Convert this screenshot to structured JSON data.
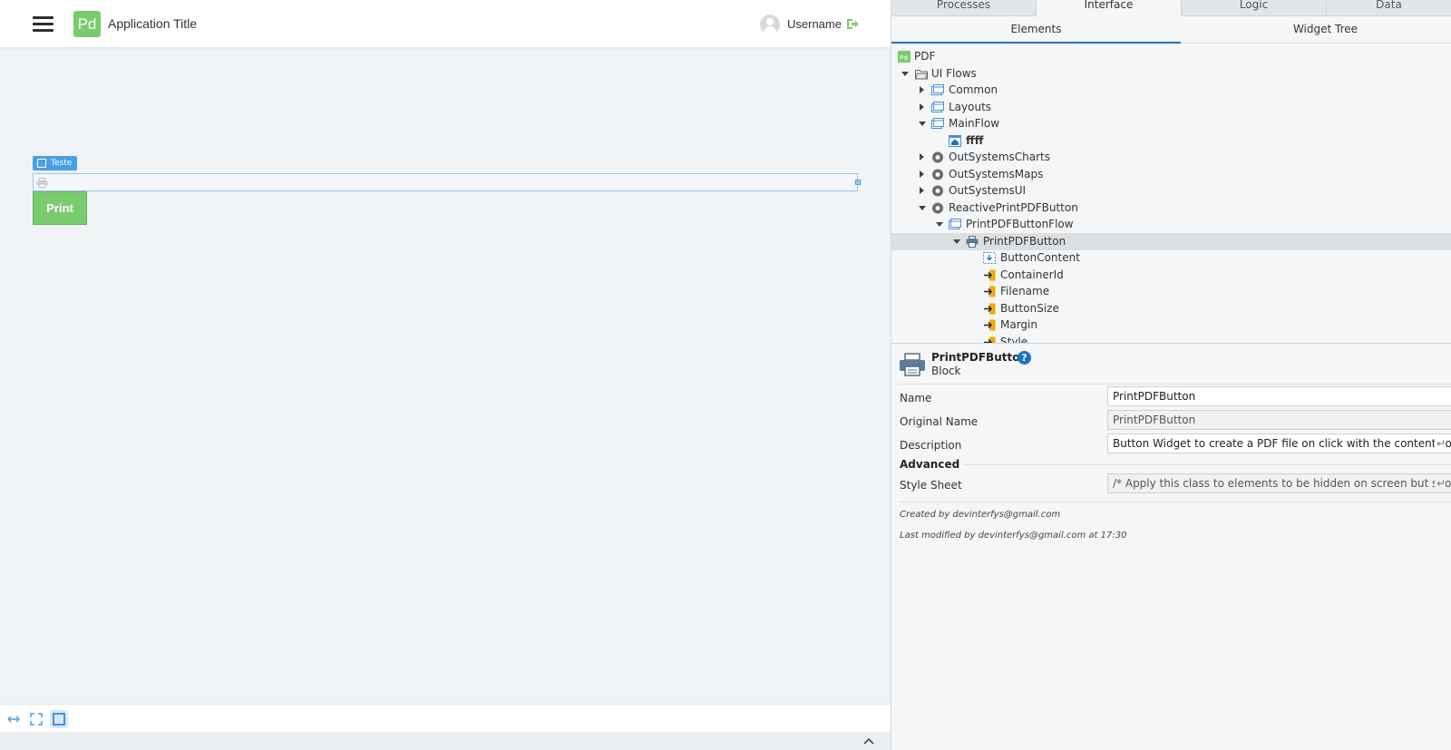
{
  "app": {
    "logo_text": "Pd",
    "title": "Application Title",
    "username": "Username",
    "brand_color": "#7acb6e"
  },
  "canvas": {
    "widget_tag": "Teste",
    "print_button": "Print"
  },
  "panel": {
    "main_tabs": [
      "Processes",
      "Interface",
      "Logic",
      "Data"
    ],
    "active_main_tab": "Interface",
    "sub_tabs": [
      "Elements",
      "Widget Tree"
    ],
    "active_sub_tab": "Elements",
    "tree": [
      {
        "label": "PDF",
        "icon": "module-icon"
      },
      {
        "label": "UI Flows",
        "icon": "folder-open-icon"
      },
      {
        "label": "Common",
        "icon": "flow-icon"
      },
      {
        "label": "Layouts",
        "icon": "flow-icon"
      },
      {
        "label": "MainFlow",
        "icon": "flow-icon"
      },
      {
        "label": "ffff",
        "icon": "screen-home-icon"
      },
      {
        "label": "OutSystemsCharts",
        "icon": "dependency-icon"
      },
      {
        "label": "OutSystemsMaps",
        "icon": "dependency-icon"
      },
      {
        "label": "OutSystemsUI",
        "icon": "dependency-icon"
      },
      {
        "label": "ReactivePrintPDFButton",
        "icon": "dependency-icon"
      },
      {
        "label": "PrintPDFButtonFlow",
        "icon": "flow-icon"
      },
      {
        "label": "PrintPDFButton",
        "icon": "printer-icon"
      },
      {
        "label": "ButtonContent",
        "icon": "placeholder-icon"
      },
      {
        "label": "ContainerId",
        "icon": "input-parameter-icon"
      },
      {
        "label": "Filename",
        "icon": "input-parameter-icon"
      },
      {
        "label": "ButtonSize",
        "icon": "input-parameter-icon"
      },
      {
        "label": "Margin",
        "icon": "input-parameter-icon"
      },
      {
        "label": "Style",
        "icon": "input-parameter-icon"
      }
    ],
    "properties": {
      "title": "PrintPDFButton",
      "type": "Block",
      "help": "?",
      "name_label": "Name",
      "name_value": "PrintPDFButton",
      "original_name_label": "Original Name",
      "original_name_value": "PrintPDFButton",
      "description_label": "Description",
      "description_value": "Button Widget to create a PDF file on click with the contents of a Container",
      "advanced_header": "Advanced",
      "style_sheet_label": "Style Sheet",
      "style_sheet_value": "/* Apply this class to elements to be hidden on screen but shown on print */",
      "enter_symbol": "↵",
      "created_by": "Created by devinterfys@gmail.com",
      "last_modified": "Last modified by devinterfys@gmail.com at 17:30"
    }
  }
}
